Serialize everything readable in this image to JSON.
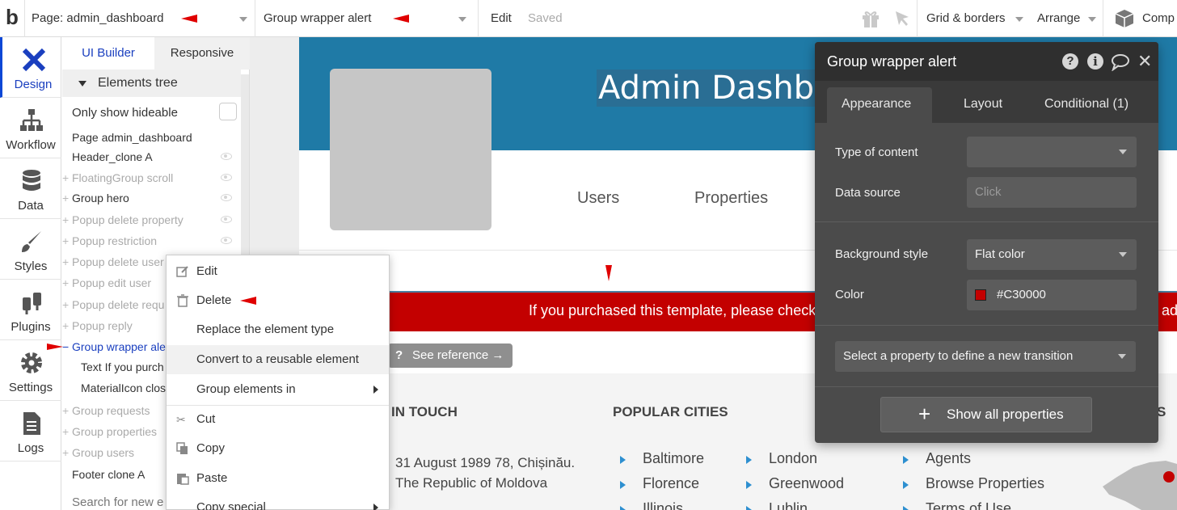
{
  "topbar": {
    "logo": "b",
    "page_selector": "Page: admin_dashboard",
    "element_selector": "Group wrapper alert",
    "edit": "Edit",
    "saved": "Saved",
    "grid_borders": "Grid & borders",
    "arrange": "Arrange",
    "components": "Comp"
  },
  "leftnav": {
    "items": [
      {
        "label": "Design",
        "icon": "design-icon"
      },
      {
        "label": "Workflow",
        "icon": "workflow-icon"
      },
      {
        "label": "Data",
        "icon": "database-icon"
      },
      {
        "label": "Styles",
        "icon": "brush-icon"
      },
      {
        "label": "Plugins",
        "icon": "plug-icon"
      },
      {
        "label": "Settings",
        "icon": "gear-icon"
      },
      {
        "label": "Logs",
        "icon": "document-icon"
      }
    ]
  },
  "panel": {
    "tabs": [
      "UI Builder",
      "Responsive"
    ],
    "tree_header": "Elements tree",
    "only_hideable": "Only show hideable",
    "search_placeholder": "Search for new e",
    "tree": [
      {
        "label": "Page admin_dashboard",
        "dim": false,
        "plus": false,
        "eye": false
      },
      {
        "label": "Header_clone A",
        "dim": false,
        "plus": false,
        "eye": true
      },
      {
        "label": "FloatingGroup scroll",
        "dim": true,
        "plus": true,
        "eye": true
      },
      {
        "label": "Group hero",
        "dim": false,
        "plus": true,
        "eye": true
      },
      {
        "label": "Popup delete property",
        "dim": true,
        "plus": true,
        "eye": true
      },
      {
        "label": "Popup restriction",
        "dim": true,
        "plus": true,
        "eye": true
      },
      {
        "label": "Popup delete user",
        "dim": true,
        "plus": true,
        "eye": false
      },
      {
        "label": "Popup edit user",
        "dim": true,
        "plus": true,
        "eye": false
      },
      {
        "label": "Popup delete requ",
        "dim": true,
        "plus": true,
        "eye": false
      },
      {
        "label": "Popup reply",
        "dim": true,
        "plus": true,
        "eye": false
      },
      {
        "label": "Group wrapper ale",
        "dim": false,
        "plus": false,
        "eye": false,
        "selected": true
      },
      {
        "label": "Text If you purch",
        "dim": false,
        "plus": false,
        "eye": false,
        "indent": true
      },
      {
        "label": "MaterialIcon clos",
        "dim": false,
        "plus": false,
        "eye": false,
        "indent": true
      },
      {
        "label": "Group requests",
        "dim": true,
        "plus": true,
        "eye": false
      },
      {
        "label": "Group properties",
        "dim": true,
        "plus": true,
        "eye": false
      },
      {
        "label": "Group users",
        "dim": true,
        "plus": true,
        "eye": false
      },
      {
        "label": "Footer clone A",
        "dim": false,
        "plus": false,
        "eye": false
      }
    ]
  },
  "canvas": {
    "title": "Admin Dashbo",
    "nav_users": "Users",
    "nav_properties": "Properties",
    "alert_text": "If you purchased this template, please check",
    "alert_tail": "ad",
    "footer": {
      "col1_head": "IN TOUCH",
      "col1_lines": [
        "31 August 1989 78, Chișinău.",
        "The Republic of Moldova"
      ],
      "col2_head": "POPULAR CITIES",
      "col2_links": [
        "Baltimore",
        "Florence",
        "Illinois"
      ],
      "col3_links": [
        "London",
        "Greenwood",
        "Lublin"
      ],
      "col4_links": [
        "Agents",
        "Browse Properties",
        "Terms of Use"
      ],
      "col5_head_tail": "S"
    }
  },
  "context_menu": {
    "items": [
      "Edit",
      "Delete",
      "Replace the element type",
      "Convert to a reusable element",
      "Group elements in",
      "Cut",
      "Copy",
      "Paste",
      "Copy special"
    ]
  },
  "see_reference": "See reference →",
  "property_editor": {
    "title": "Group wrapper alert",
    "tabs": [
      "Appearance",
      "Layout",
      "Conditional (1)"
    ],
    "type_of_content_label": "Type of content",
    "type_of_content_value": "",
    "data_source_label": "Data source",
    "data_source_placeholder": "Click",
    "background_style_label": "Background style",
    "background_style_value": "Flat color",
    "color_label": "Color",
    "color_value": "#C30000",
    "transition_placeholder": "Select a property to define a new transition",
    "show_all": "Show all properties"
  },
  "colors": {
    "accent_blue": "#1a3fbf",
    "header_blue": "#1f7aa6",
    "alert_red": "#C30000",
    "annotation_red": "#e00000",
    "editor_bg": "#4b4b4b"
  }
}
